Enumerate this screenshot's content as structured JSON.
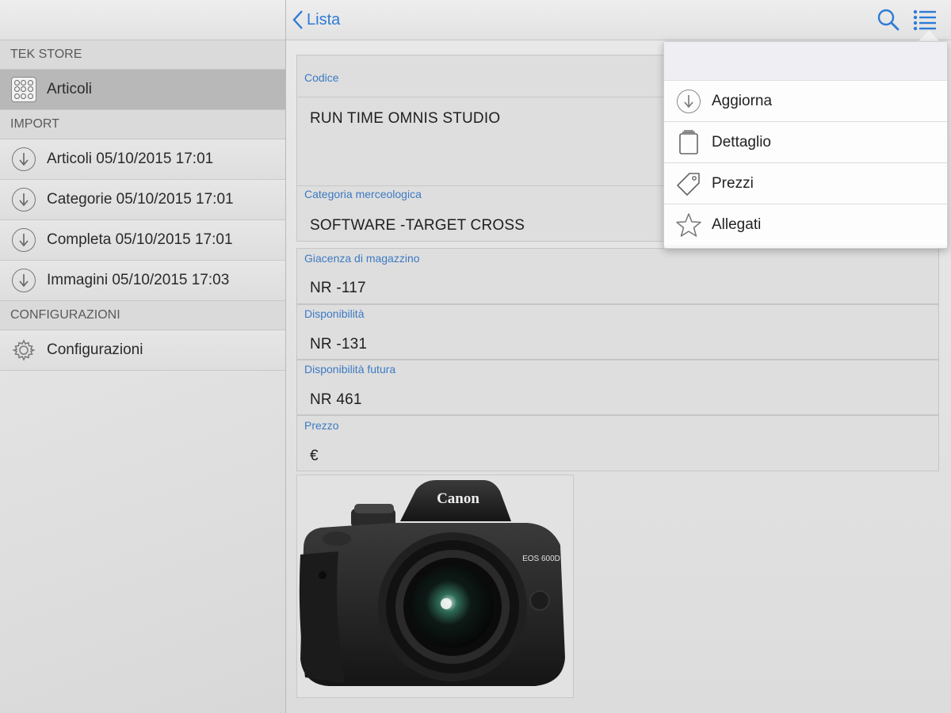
{
  "sidebar": {
    "sections": {
      "tek_store": "TEK STORE",
      "import": "IMPORT",
      "configurazioni": "CONFIGURAZIONI"
    },
    "articoli_label": "Articoli",
    "import_items": [
      {
        "label": "Articoli 05/10/2015 17:01",
        "icon": "download-icon"
      },
      {
        "label": "Categorie 05/10/2015 17:01",
        "icon": "download-icon"
      },
      {
        "label": "Completa 05/10/2015 17:01",
        "icon": "download-icon"
      },
      {
        "label": "Immagini 05/10/2015 17:03",
        "icon": "download-icon"
      }
    ],
    "config_label": "Configurazioni"
  },
  "header": {
    "back_label": "Lista",
    "accent_color": "#2e7bd6"
  },
  "detail": {
    "codice": {
      "label": "Codice",
      "value": "RUN TIME OMNIS STUDIO"
    },
    "categoria": {
      "label": "Categoria merceologica",
      "value": "SOFTWARE -TARGET CROSS"
    },
    "giacenza": {
      "label": "Giacenza di magazzino",
      "value": "NR -117"
    },
    "disponibilita": {
      "label": "Disponibilità",
      "value": "NR -131"
    },
    "disponibilita_futura": {
      "label": "Disponibilità futura",
      "value": "NR 461"
    },
    "prezzo": {
      "label": "Prezzo",
      "value": "€"
    },
    "image": {
      "brand": "Canon",
      "model": "EOS 600D"
    }
  },
  "menu": {
    "items": [
      {
        "label": "Aggiorna",
        "icon": "download-icon"
      },
      {
        "label": "Dettaglio",
        "icon": "document-icon"
      },
      {
        "label": "Prezzi",
        "icon": "price-tag-icon"
      },
      {
        "label": "Allegati",
        "icon": "star-icon"
      }
    ]
  }
}
